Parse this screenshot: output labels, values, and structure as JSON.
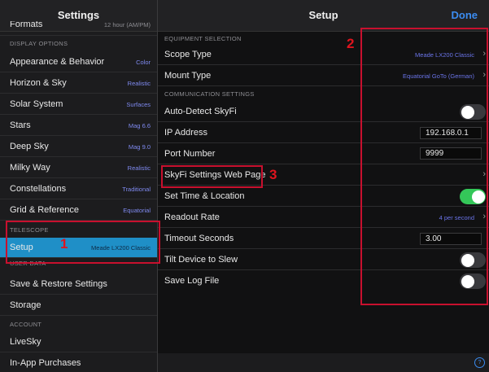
{
  "left_panel": {
    "title": "Settings",
    "top_cut": {
      "label": "Formats",
      "value": "12 hour (AM/PM)"
    },
    "sections": {
      "display_options": "DISPLAY OPTIONS",
      "telescope": "TELESCOPE",
      "user_data": "USER DATA",
      "account": "ACCOUNT"
    },
    "display_items": [
      {
        "label": "Appearance & Behavior",
        "value": "Color"
      },
      {
        "label": "Horizon & Sky",
        "value": "Realistic"
      },
      {
        "label": "Solar System",
        "value": "Surfaces"
      },
      {
        "label": "Stars",
        "value": "Mag 6.6"
      },
      {
        "label": "Deep Sky",
        "value": "Mag 9.0"
      },
      {
        "label": "Milky Way",
        "value": "Realistic"
      },
      {
        "label": "Constellations",
        "value": "Traditional"
      },
      {
        "label": "Grid & Reference",
        "value": "Equatorial"
      }
    ],
    "setup": {
      "label": "Setup",
      "value": "Meade LX200 Classic"
    },
    "user_items": [
      {
        "label": "Save & Restore Settings"
      },
      {
        "label": "Storage"
      }
    ],
    "account_items": [
      {
        "label": "LiveSky"
      },
      {
        "label": "In-App Purchases"
      }
    ]
  },
  "right_panel": {
    "title": "Setup",
    "done": "Done",
    "sections": {
      "equipment": "EQUIPMENT SELECTION",
      "communication": "COMMUNICATION SETTINGS"
    },
    "scope_type": {
      "label": "Scope Type",
      "value": "Meade LX200 Classic"
    },
    "mount_type": {
      "label": "Mount Type",
      "value": "Equatorial GoTo (German)"
    },
    "auto_detect": {
      "label": "Auto-Detect SkyFi",
      "on": false
    },
    "ip_address": {
      "label": "IP Address",
      "value": "192.168.0.1"
    },
    "port_number": {
      "label": "Port Number",
      "value": "9999"
    },
    "web_page": {
      "label": "SkyFi Settings Web Page"
    },
    "set_time": {
      "label": "Set Time & Location",
      "on": true
    },
    "readout_rate": {
      "label": "Readout Rate",
      "value": "4 per second"
    },
    "timeout": {
      "label": "Timeout Seconds",
      "value": "3.00"
    },
    "tilt": {
      "label": "Tilt Device to Slew",
      "on": false
    },
    "save_log": {
      "label": "Save Log File",
      "on": false
    }
  },
  "annotations": {
    "label_1": "1",
    "label_2": "2",
    "label_3": "3"
  },
  "icons": {
    "chevron": "chevron-right-icon",
    "help": "help-icon"
  },
  "colors": {
    "accent": "#3b8cf0",
    "selection": "#1f8fc7",
    "toggle_on": "#34c759",
    "annotation": "#c8102e"
  }
}
